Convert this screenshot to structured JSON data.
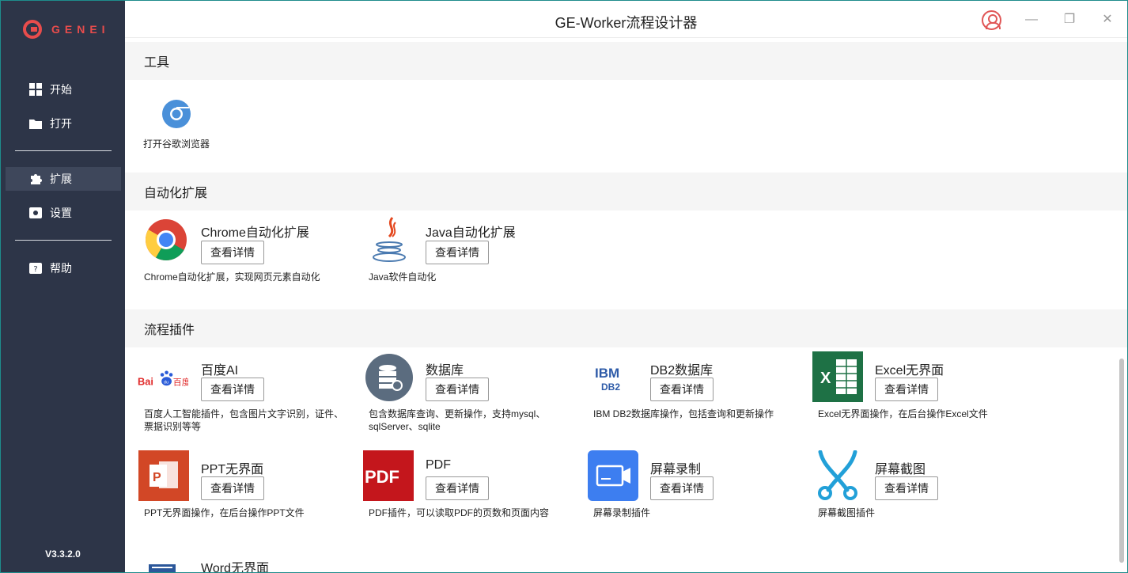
{
  "app": {
    "logo_text": "GENEI",
    "title": "GE-Worker流程设计器",
    "version": "V3.3.2.0"
  },
  "sidebar": {
    "items": [
      {
        "label": "开始",
        "icon": "grid-icon"
      },
      {
        "label": "打开",
        "icon": "folder-icon"
      },
      {
        "label": "扩展",
        "icon": "puzzle-icon",
        "active": true
      },
      {
        "label": "设置",
        "icon": "settings-icon"
      },
      {
        "label": "帮助",
        "icon": "help-icon"
      }
    ]
  },
  "window_controls": {
    "minimize": "—",
    "restore": "❐",
    "close": "✕"
  },
  "sections": {
    "tools": {
      "title": "工具",
      "items": [
        {
          "label": "打开谷歌浏览器",
          "icon": "chrome-browser-icon"
        }
      ]
    },
    "automation": {
      "title": "自动化扩展",
      "items": [
        {
          "title": "Chrome自动化扩展",
          "button": "查看详情",
          "desc": "Chrome自动化扩展，实现网页元素自动化",
          "icon": "chrome-icon"
        },
        {
          "title": "Java自动化扩展",
          "button": "查看详情",
          "desc": "Java软件自动化",
          "icon": "java-icon"
        }
      ]
    },
    "plugins": {
      "title": "流程插件",
      "items": [
        {
          "title": "百度AI",
          "button": "查看详情",
          "desc": "百度人工智能插件，包含图片文字识别，证件、票据识别等等",
          "icon": "baidu-icon"
        },
        {
          "title": "数据库",
          "button": "查看详情",
          "desc": "包含数据库查询、更新操作，支持mysql、sqlServer、sqlite",
          "icon": "database-icon"
        },
        {
          "title": "DB2数据库",
          "button": "查看详情",
          "desc": "IBM DB2数据库操作，包括查询和更新操作",
          "icon": "ibm-db2-icon"
        },
        {
          "title": "Excel无界面",
          "button": "查看详情",
          "desc": "Excel无界面操作，在后台操作Excel文件",
          "icon": "excel-icon"
        },
        {
          "title": "PPT无界面",
          "button": "查看详情",
          "desc": "PPT无界面操作，在后台操作PPT文件",
          "icon": "ppt-icon"
        },
        {
          "title": "PDF",
          "button": "查看详情",
          "desc": "PDF插件，可以读取PDF的页数和页面内容",
          "icon": "pdf-icon"
        },
        {
          "title": "屏幕录制",
          "button": "查看详情",
          "desc": "屏幕录制插件",
          "icon": "screen-record-icon"
        },
        {
          "title": "屏幕截图",
          "button": "查看详情",
          "desc": "屏幕截图插件",
          "icon": "screenshot-icon"
        },
        {
          "title": "Word无界面",
          "button": "",
          "desc": "",
          "icon": "word-icon"
        }
      ]
    }
  }
}
